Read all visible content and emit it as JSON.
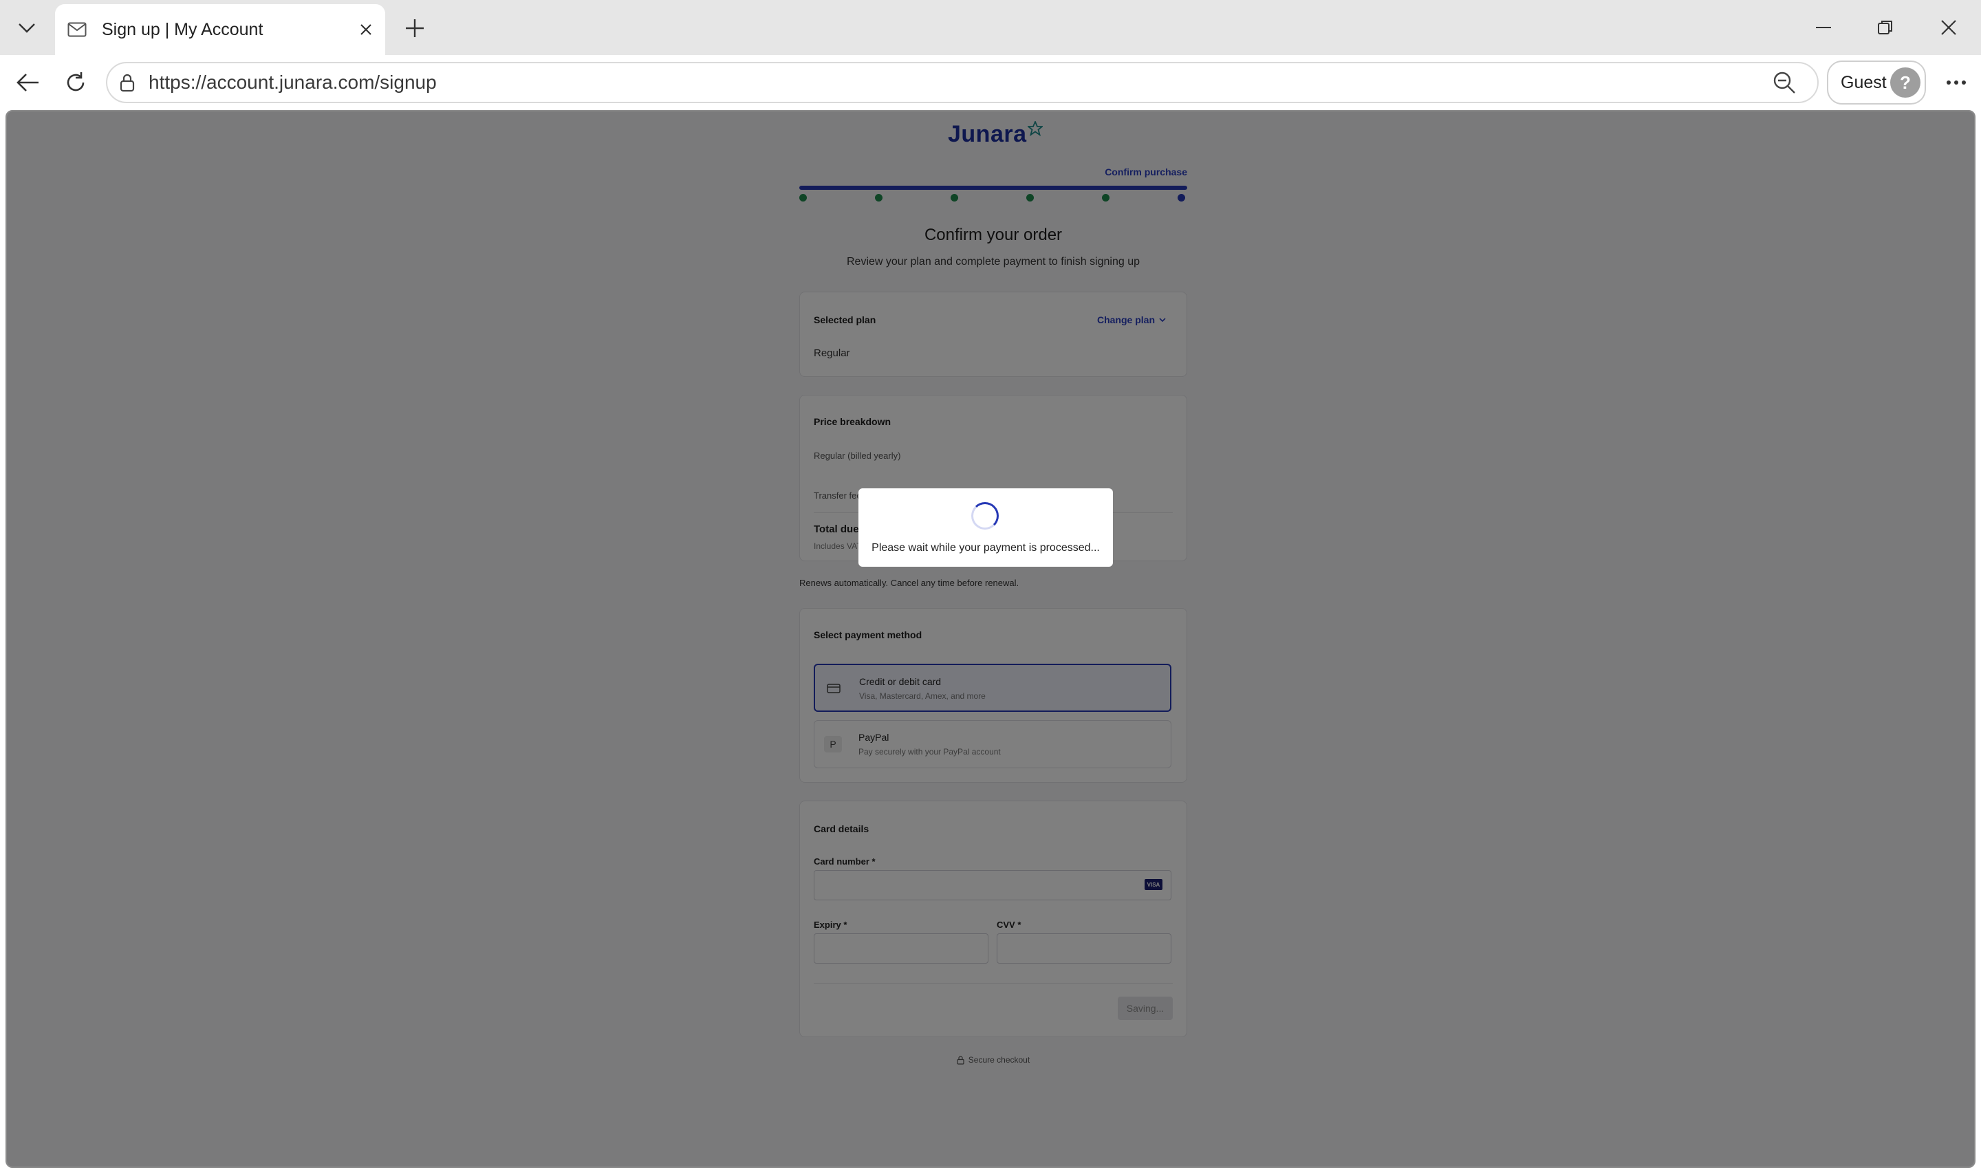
{
  "browser": {
    "tab_title": "Sign up | My Account",
    "url": "https://account.junara.com/signup",
    "profile_name": "Guest"
  },
  "page": {
    "logo": "Junara",
    "step_label": "Confirm purchase",
    "heading": "Confirm your order",
    "subheading": "Review your plan and complete payment to finish signing up",
    "selected_plan": {
      "title": "Selected plan",
      "change_label": "Change plan",
      "plan_name": "Regular"
    },
    "price_breakdown": {
      "title": "Price breakdown",
      "line1": "Regular (billed yearly)",
      "line2": "Transfer fee",
      "total_label": "Total due today",
      "vat_note": "Includes VAT @ 20%"
    },
    "renew_note": "Renews automatically. Cancel any time before renewal.",
    "payment": {
      "title": "Select payment method",
      "options": [
        {
          "name": "Credit or debit card",
          "desc": "Visa, Mastercard, Amex, and more",
          "icon": "card-icon"
        },
        {
          "name": "PayPal",
          "desc": "Pay securely with your PayPal account",
          "icon": "paypal-icon",
          "icon_letter": "P"
        }
      ]
    },
    "card_details": {
      "title": "Card details",
      "card_number_label": "Card number *",
      "expiry_label": "Expiry *",
      "cvv_label": "CVV *",
      "card_brand": "VISA",
      "save_button": "Saving..."
    },
    "secure_note": "Secure checkout"
  },
  "modal": {
    "message": "Please wait while your payment is processed..."
  },
  "colors": {
    "brand": "#1d2f9e",
    "accent": "#2638b5",
    "complete_step": "#1f8a4c",
    "overlay": "rgba(0,0,0,0.5)"
  }
}
